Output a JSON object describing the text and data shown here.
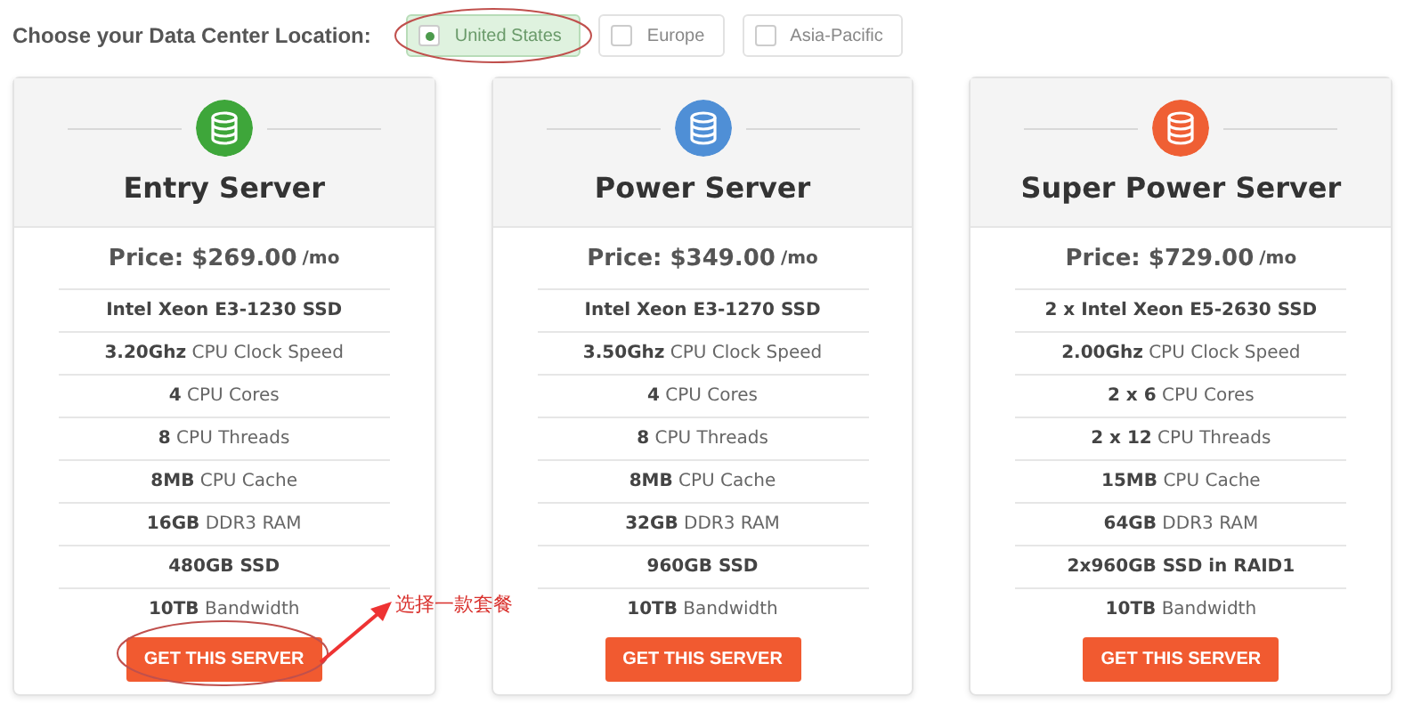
{
  "location": {
    "label": "Choose your Data Center Location:",
    "options": [
      {
        "label": "United States",
        "selected": true
      },
      {
        "label": "Europe",
        "selected": false
      },
      {
        "label": "Asia-Pacific",
        "selected": false
      }
    ]
  },
  "plans": [
    {
      "name": "Entry Server",
      "color": "#3ea63a",
      "price": "Price: $269.00",
      "period": "/mo",
      "specs": [
        {
          "text": "Intel Xeon E3-1230 SSD",
          "bold": true
        },
        {
          "text": "**3.20Ghz** CPU Clock Speed",
          "bold": false
        },
        {
          "text": "**4** CPU Cores",
          "bold": false
        },
        {
          "text": "**8** CPU Threads",
          "bold": false
        },
        {
          "text": "**8MB** CPU Cache",
          "bold": false
        },
        {
          "text": "**16GB** DDR3 RAM",
          "bold": false
        },
        {
          "text": "480GB SSD",
          "bold": true
        },
        {
          "text": "**10TB** Bandwidth",
          "bold": false
        }
      ],
      "button": "GET THIS SERVER"
    },
    {
      "name": "Power Server",
      "color": "#4f8fd6",
      "price": "Price: $349.00",
      "period": "/mo",
      "specs": [
        {
          "text": "Intel Xeon E3-1270 SSD",
          "bold": true
        },
        {
          "text": "**3.50Ghz** CPU Clock Speed",
          "bold": false
        },
        {
          "text": "**4** CPU Cores",
          "bold": false
        },
        {
          "text": "**8** CPU Threads",
          "bold": false
        },
        {
          "text": "**8MB** CPU Cache",
          "bold": false
        },
        {
          "text": "**32GB** DDR3 RAM",
          "bold": false
        },
        {
          "text": "960GB SSD",
          "bold": true
        },
        {
          "text": "**10TB** Bandwidth",
          "bold": false
        }
      ],
      "button": "GET THIS SERVER"
    },
    {
      "name": "Super Power Server",
      "color": "#ef5f34",
      "price": "Price: $729.00",
      "period": "/mo",
      "specs": [
        {
          "text": "2 x Intel Xeon E5-2630 SSD",
          "bold": true
        },
        {
          "text": "**2.00Ghz** CPU Clock Speed",
          "bold": false
        },
        {
          "text": "**2 x 6** CPU Cores",
          "bold": false
        },
        {
          "text": "**2 x 12** CPU Threads",
          "bold": false
        },
        {
          "text": "**15MB** CPU Cache",
          "bold": false
        },
        {
          "text": "**64GB** DDR3 RAM",
          "bold": false
        },
        {
          "text": "2x960GB SSD in RAID1",
          "bold": true
        },
        {
          "text": "**10TB** Bandwidth",
          "bold": false
        }
      ],
      "button": "GET THIS SERVER"
    }
  ],
  "annotation": {
    "text": "选择一款套餐"
  }
}
